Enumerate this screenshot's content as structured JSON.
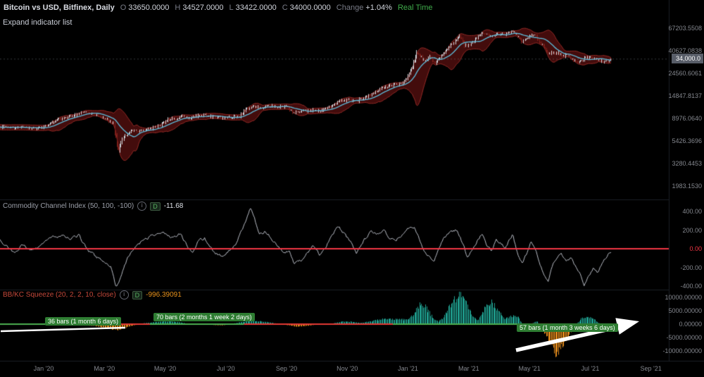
{
  "header": {
    "symbol": "Bitcoin vs USD, Bitfinex, Daily",
    "ohlc": {
      "o_label": "O",
      "o_value": "33650.0000",
      "h_label": "H",
      "h_value": "34527.0000",
      "l_label": "L",
      "l_value": "33422.0000",
      "c_label": "C",
      "c_value": "34000.0000"
    },
    "change_label": "Change",
    "change_value": "+1.04%",
    "realtime_label": "Real Time"
  },
  "toolbar": {
    "expand_link": "Expand indicator list"
  },
  "panes": {
    "cci": {
      "title": "Commodity Channel Index (50, 100, -100)",
      "info_icon": "i",
      "interval_badge": "D",
      "value": "-11.68"
    },
    "squeeze": {
      "title": "BB/KC Squeeze (20, 2, 2, 10, close)",
      "info_icon": "i",
      "interval_badge": "D",
      "value": "-996.39091"
    }
  },
  "axes": {
    "price_ticks": [
      "67203.5508",
      "40627.0838",
      "24560.6061",
      "14847.8137",
      "8976.0640",
      "5426.3696",
      "3280.4453",
      "1983.1530"
    ],
    "last_price_badge": "34,000.0",
    "cci_ticks": [
      "400.00",
      "200.00",
      "0.00",
      "-200.00",
      "-400.00"
    ],
    "squeeze_ticks": [
      "10000.00000",
      "5000.00000",
      "0.00000",
      "-5000.00000",
      "-10000.00000"
    ],
    "time_ticks": [
      "Jan '20",
      "Mar '20",
      "May '20",
      "Jul '20",
      "Sep '20",
      "Nov '20",
      "Jan '21",
      "Mar '21",
      "May '21",
      "Jul '21",
      "Sep '21"
    ]
  },
  "annotations": {
    "bars_36": "36 bars (1 month 6 days)",
    "bars_70": "70 bars (2 months 1 week 2 days)",
    "bars_57": "57 bars (1 month 3 weeks 6 days)"
  },
  "chart_data": {
    "type": "candlestick",
    "title": "Bitcoin vs USD, Bitfinex, Daily",
    "x_unit": "months_since_jan_2020",
    "x_range": [
      -2.2,
      18.72
    ],
    "price": {
      "scale": "log",
      "ylim": [
        1800,
        70000
      ],
      "axis_ticks": [
        67203.5508,
        40627.0838,
        24560.6061,
        14847.8137,
        8976.064,
        5426.3696,
        3280.4453,
        1983.153
      ],
      "last_close": 34000,
      "ohlc_last": {
        "open": 33650,
        "high": 34527,
        "low": 33422,
        "close": 34000,
        "change_pct": 1.04
      },
      "anchors": [
        [
          -2.2,
          7900
        ],
        [
          -1.9,
          7500
        ],
        [
          -1.6,
          7250
        ],
        [
          -1.3,
          7550
        ],
        [
          -1.0,
          7200
        ],
        [
          -0.7,
          7400
        ],
        [
          -0.4,
          7150
        ],
        [
          -0.1,
          7200
        ],
        [
          0.15,
          7800
        ],
        [
          0.4,
          8650
        ],
        [
          0.7,
          9150
        ],
        [
          1.0,
          9550
        ],
        [
          1.3,
          10300
        ],
        [
          1.55,
          9950
        ],
        [
          1.8,
          9650
        ],
        [
          2.05,
          8850
        ],
        [
          2.3,
          7950
        ],
        [
          2.42,
          4950
        ],
        [
          2.47,
          4400
        ],
        [
          2.55,
          5450
        ],
        [
          2.7,
          6250
        ],
        [
          2.9,
          6750
        ],
        [
          3.2,
          6850
        ],
        [
          3.5,
          7100
        ],
        [
          3.8,
          7550
        ],
        [
          4.1,
          8800
        ],
        [
          4.35,
          8950
        ],
        [
          4.6,
          9750
        ],
        [
          4.8,
          8750
        ],
        [
          5.0,
          9500
        ],
        [
          5.3,
          9680
        ],
        [
          5.6,
          9280
        ],
        [
          5.9,
          9120
        ],
        [
          6.2,
          9230
        ],
        [
          6.45,
          9550
        ],
        [
          6.65,
          11050
        ],
        [
          6.9,
          11720
        ],
        [
          7.15,
          11400
        ],
        [
          7.45,
          11900
        ],
        [
          7.7,
          11550
        ],
        [
          8.0,
          11680
        ],
        [
          8.2,
          10250
        ],
        [
          8.5,
          10480
        ],
        [
          8.8,
          10780
        ],
        [
          9.1,
          10620
        ],
        [
          9.4,
          11480
        ],
        [
          9.7,
          13120
        ],
        [
          10.0,
          13560
        ],
        [
          10.25,
          13050
        ],
        [
          10.55,
          14100
        ],
        [
          10.85,
          15480
        ],
        [
          11.1,
          17700
        ],
        [
          11.35,
          18420
        ],
        [
          11.6,
          19180
        ],
        [
          11.85,
          19650
        ],
        [
          12.0,
          23400
        ],
        [
          12.15,
          29000
        ],
        [
          12.28,
          40200
        ],
        [
          12.42,
          35600
        ],
        [
          12.56,
          31500
        ],
        [
          12.7,
          36000
        ],
        [
          12.85,
          30420
        ],
        [
          13.0,
          33100
        ],
        [
          13.2,
          38900
        ],
        [
          13.4,
          46300
        ],
        [
          13.55,
          49200
        ],
        [
          13.7,
          57400
        ],
        [
          13.85,
          46300
        ],
        [
          14.0,
          45100
        ],
        [
          14.15,
          49600
        ],
        [
          14.3,
          54800
        ],
        [
          14.45,
          61200
        ],
        [
          14.6,
          57300
        ],
        [
          14.75,
          54900
        ],
        [
          14.9,
          58900
        ],
        [
          15.05,
          58700
        ],
        [
          15.2,
          58300
        ],
        [
          15.45,
          63500
        ],
        [
          15.6,
          56200
        ],
        [
          15.75,
          49000
        ],
        [
          15.9,
          53800
        ],
        [
          16.05,
          57750
        ],
        [
          16.2,
          56700
        ],
        [
          16.35,
          49100
        ],
        [
          16.5,
          43550
        ],
        [
          16.62,
          37000
        ],
        [
          16.72,
          40200
        ],
        [
          16.82,
          37300
        ],
        [
          16.95,
          39000
        ],
        [
          17.1,
          35600
        ],
        [
          17.25,
          37350
        ],
        [
          17.4,
          33600
        ],
        [
          17.55,
          31620
        ],
        [
          17.7,
          32500
        ],
        [
          17.85,
          35300
        ],
        [
          18.0,
          34680
        ],
        [
          18.15,
          33800
        ],
        [
          18.3,
          32850
        ],
        [
          18.45,
          31800
        ],
        [
          18.55,
          32120
        ],
        [
          18.65,
          33650
        ],
        [
          18.72,
          34000
        ]
      ]
    },
    "bollinger": {
      "window": 20,
      "mult": 2
    },
    "cci": {
      "params": [
        50,
        100,
        -100
      ],
      "last": -11.68,
      "ylim": [
        -500,
        500
      ],
      "axis_ticks": [
        400,
        200,
        0,
        -200,
        -400
      ],
      "anchors": [
        [
          -2.2,
          40
        ],
        [
          -1.95,
          90
        ],
        [
          -1.7,
          20
        ],
        [
          -1.45,
          95
        ],
        [
          -1.2,
          30
        ],
        [
          -0.95,
          -55
        ],
        [
          -0.7,
          45
        ],
        [
          -0.45,
          -25
        ],
        [
          -0.2,
          20
        ],
        [
          0.05,
          70
        ],
        [
          0.3,
          125
        ],
        [
          0.6,
          145
        ],
        [
          0.9,
          105
        ],
        [
          1.15,
          150
        ],
        [
          1.45,
          -15
        ],
        [
          1.75,
          -90
        ],
        [
          2.0,
          -140
        ],
        [
          2.2,
          -185
        ],
        [
          2.38,
          -400
        ],
        [
          2.55,
          -295
        ],
        [
          2.75,
          -115
        ],
        [
          2.95,
          -5
        ],
        [
          3.15,
          60
        ],
        [
          3.35,
          105
        ],
        [
          3.6,
          135
        ],
        [
          3.9,
          175
        ],
        [
          4.2,
          115
        ],
        [
          4.5,
          160
        ],
        [
          4.7,
          55
        ],
        [
          4.9,
          -45
        ],
        [
          5.1,
          85
        ],
        [
          5.3,
          115
        ],
        [
          5.6,
          -35
        ],
        [
          5.9,
          -85
        ],
        [
          6.1,
          -15
        ],
        [
          6.35,
          65
        ],
        [
          6.6,
          255
        ],
        [
          6.8,
          425
        ],
        [
          6.95,
          330
        ],
        [
          7.1,
          145
        ],
        [
          7.3,
          185
        ],
        [
          7.5,
          115
        ],
        [
          7.7,
          35
        ],
        [
          7.9,
          -35
        ],
        [
          8.1,
          -15
        ],
        [
          8.25,
          -165
        ],
        [
          8.5,
          -120
        ],
        [
          8.7,
          -40
        ],
        [
          8.9,
          35
        ],
        [
          9.1,
          -65
        ],
        [
          9.3,
          25
        ],
        [
          9.5,
          135
        ],
        [
          9.7,
          245
        ],
        [
          9.9,
          160
        ],
        [
          10.1,
          75
        ],
        [
          10.3,
          -45
        ],
        [
          10.55,
          95
        ],
        [
          10.8,
          185
        ],
        [
          11.0,
          160
        ],
        [
          11.2,
          195
        ],
        [
          11.4,
          120
        ],
        [
          11.6,
          100
        ],
        [
          11.8,
          145
        ],
        [
          12.0,
          215
        ],
        [
          12.2,
          235
        ],
        [
          12.35,
          140
        ],
        [
          12.5,
          0
        ],
        [
          12.65,
          -65
        ],
        [
          12.85,
          -125
        ],
        [
          13.0,
          -15
        ],
        [
          13.2,
          125
        ],
        [
          13.4,
          175
        ],
        [
          13.6,
          205
        ],
        [
          13.8,
          60
        ],
        [
          13.95,
          -85
        ],
        [
          14.1,
          -20
        ],
        [
          14.3,
          95
        ],
        [
          14.45,
          165
        ],
        [
          14.6,
          40
        ],
        [
          14.75,
          -25
        ],
        [
          14.9,
          85
        ],
        [
          15.05,
          60
        ],
        [
          15.2,
          15
        ],
        [
          15.45,
          155
        ],
        [
          15.6,
          -45
        ],
        [
          15.75,
          -155
        ],
        [
          15.9,
          -60
        ],
        [
          16.05,
          75
        ],
        [
          16.2,
          -5
        ],
        [
          16.35,
          -185
        ],
        [
          16.5,
          -285
        ],
        [
          16.62,
          -355
        ],
        [
          16.75,
          -180
        ],
        [
          16.9,
          -90
        ],
        [
          17.05,
          -60
        ],
        [
          17.2,
          -135
        ],
        [
          17.35,
          -85
        ],
        [
          17.5,
          -175
        ],
        [
          17.65,
          -245
        ],
        [
          17.8,
          -395
        ],
        [
          17.95,
          -300
        ],
        [
          18.1,
          -205
        ],
        [
          18.25,
          -255
        ],
        [
          18.4,
          -160
        ],
        [
          18.55,
          -85
        ],
        [
          18.72,
          -11.68
        ]
      ]
    },
    "squeeze": {
      "params": [
        20,
        2,
        2,
        10,
        "close"
      ],
      "last": -996.39091,
      "ylim": [
        -12500,
        12500
      ],
      "axis_ticks": [
        10000,
        5000,
        0,
        -5000,
        -10000
      ],
      "anchors": [
        [
          -2.2,
          150
        ],
        [
          -1.8,
          320
        ],
        [
          -1.45,
          250
        ],
        [
          -1.1,
          -200
        ],
        [
          -0.7,
          150
        ],
        [
          -0.3,
          -120
        ],
        [
          0.1,
          380
        ],
        [
          0.5,
          680
        ],
        [
          0.9,
          480
        ],
        [
          1.3,
          -280
        ],
        [
          1.7,
          -680
        ],
        [
          2.1,
          -1450
        ],
        [
          2.4,
          -2150
        ],
        [
          2.65,
          -1450
        ],
        [
          2.9,
          -580
        ],
        [
          3.2,
          180
        ],
        [
          3.5,
          580
        ],
        [
          3.8,
          880
        ],
        [
          4.1,
          1080
        ],
        [
          4.4,
          780
        ],
        [
          4.7,
          280
        ],
        [
          5.0,
          -220
        ],
        [
          5.3,
          180
        ],
        [
          5.6,
          -320
        ],
        [
          5.9,
          -420
        ],
        [
          6.2,
          120
        ],
        [
          6.5,
          780
        ],
        [
          6.8,
          1380
        ],
        [
          7.1,
          1080
        ],
        [
          7.4,
          680
        ],
        [
          7.7,
          180
        ],
        [
          8.0,
          -320
        ],
        [
          8.3,
          -880
        ],
        [
          8.6,
          -680
        ],
        [
          8.9,
          -280
        ],
        [
          9.2,
          -120
        ],
        [
          9.5,
          280
        ],
        [
          9.8,
          880
        ],
        [
          10.1,
          920
        ],
        [
          10.4,
          420
        ],
        [
          10.7,
          880
        ],
        [
          11.0,
          1580
        ],
        [
          11.3,
          2080
        ],
        [
          11.6,
          1880
        ],
        [
          11.9,
          1620
        ],
        [
          12.1,
          2600
        ],
        [
          12.25,
          5200
        ],
        [
          12.4,
          7900
        ],
        [
          12.55,
          6800
        ],
        [
          12.7,
          4200
        ],
        [
          12.85,
          1800
        ],
        [
          13.0,
          950
        ],
        [
          13.15,
          2450
        ],
        [
          13.35,
          6500
        ],
        [
          13.55,
          9800
        ],
        [
          13.7,
          10900
        ],
        [
          13.85,
          8900
        ],
        [
          14.0,
          5600
        ],
        [
          14.15,
          2600
        ],
        [
          14.3,
          1450
        ],
        [
          14.45,
          4200
        ],
        [
          14.6,
          7600
        ],
        [
          14.75,
          8300
        ],
        [
          14.9,
          6200
        ],
        [
          15.05,
          3800
        ],
        [
          15.2,
          1950
        ],
        [
          15.35,
          2650
        ],
        [
          15.5,
          3600
        ],
        [
          15.65,
          2200
        ],
        [
          15.8,
          -750
        ],
        [
          15.95,
          -1650
        ],
        [
          16.1,
          350
        ],
        [
          16.25,
          1100
        ],
        [
          16.4,
          -1850
        ],
        [
          16.55,
          -4600
        ],
        [
          16.7,
          -8200
        ],
        [
          16.85,
          -10600
        ],
        [
          17.0,
          -9200
        ],
        [
          17.15,
          -6400
        ],
        [
          17.3,
          -3800
        ],
        [
          17.45,
          -1700
        ],
        [
          17.6,
          850
        ],
        [
          17.75,
          2450
        ],
        [
          17.9,
          3100
        ],
        [
          18.05,
          2300
        ],
        [
          18.2,
          1150
        ],
        [
          18.35,
          -350
        ],
        [
          18.5,
          -1150
        ],
        [
          18.6,
          -1300
        ],
        [
          18.72,
          -996.39
        ]
      ],
      "zero_segments": [
        [
          -2.2,
          0.55,
          "#4caf50"
        ],
        [
          0.55,
          3.5,
          "#e53935"
        ],
        [
          3.5,
          6.6,
          "#4caf50"
        ],
        [
          6.6,
          11.5,
          "#e53935"
        ],
        [
          11.5,
          16.05,
          "#4caf50"
        ],
        [
          16.05,
          16.75,
          "#e53935"
        ],
        [
          16.75,
          18.72,
          "#4caf50"
        ]
      ]
    },
    "colors": {
      "band_fill": "rgba(73,13,13,0.92)",
      "band_edge": "rgba(168,48,44,0.85)",
      "candle_up": "#cdd4da",
      "candle_down": "#7e1f1a",
      "ma_line": "#5cb8d5",
      "cci_line": "#b9bdc6",
      "zero_line_red": "#f23645",
      "squeeze_pos": "#1f9e8e",
      "squeeze_neg": "#e08a1c",
      "annotation_green": "#2e7d32",
      "drawing_white": "#ffffff",
      "realtime_green": "#3fab4a",
      "badge_bg": "#585d68"
    }
  }
}
